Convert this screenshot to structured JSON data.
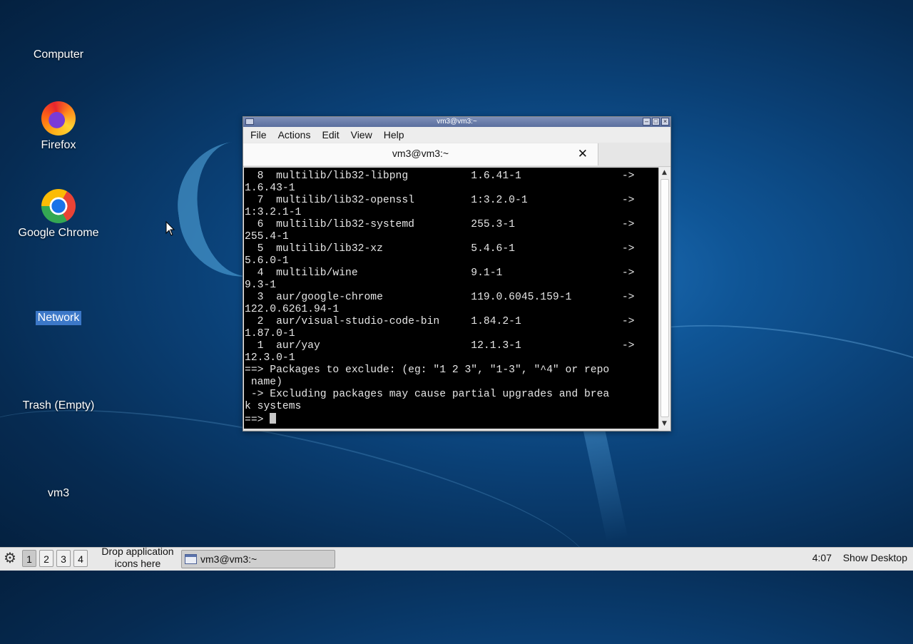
{
  "desktop": {
    "icons": [
      {
        "label": "Computer"
      },
      {
        "label": "Firefox"
      },
      {
        "label": "Google Chrome"
      },
      {
        "label": "Network"
      },
      {
        "label": "Trash (Empty)"
      },
      {
        "label": "vm3"
      }
    ],
    "selected_icon": "Network"
  },
  "terminal": {
    "window_title": "vm3@vm3:~",
    "menu": [
      "File",
      "Actions",
      "Edit",
      "View",
      "Help"
    ],
    "tab_label": "vm3@vm3:~",
    "lines": [
      "  8  multilib/lib32-libpng          1.6.41-1                ->",
      "1.6.43-1",
      "  7  multilib/lib32-openssl         1:3.2.0-1               ->",
      "1:3.2.1-1",
      "  6  multilib/lib32-systemd         255.3-1                 ->",
      "255.4-1",
      "  5  multilib/lib32-xz              5.4.6-1                 ->",
      "5.6.0-1",
      "  4  multilib/wine                  9.1-1                   ->",
      "9.3-1",
      "  3  aur/google-chrome              119.0.6045.159-1        ->",
      "122.0.6261.94-1",
      "  2  aur/visual-studio-code-bin     1.84.2-1                ->",
      "1.87.0-1",
      "  1  aur/yay                        12.1.3-1                ->",
      "12.3.0-1",
      "==> Packages to exclude: (eg: \"1 2 3\", \"1-3\", \"^4\" or repo",
      " name)",
      " -> Excluding packages may cause partial upgrades and brea",
      "k systems"
    ],
    "prompt": "==> "
  },
  "taskbar": {
    "desktops": [
      "1",
      "2",
      "3",
      "4"
    ],
    "active_desktop": "1",
    "drop_text_1": "Drop application",
    "drop_text_2": "icons here",
    "task_title": "vm3@vm3:~",
    "clock": "4:07",
    "show_desktop": "Show Desktop"
  }
}
